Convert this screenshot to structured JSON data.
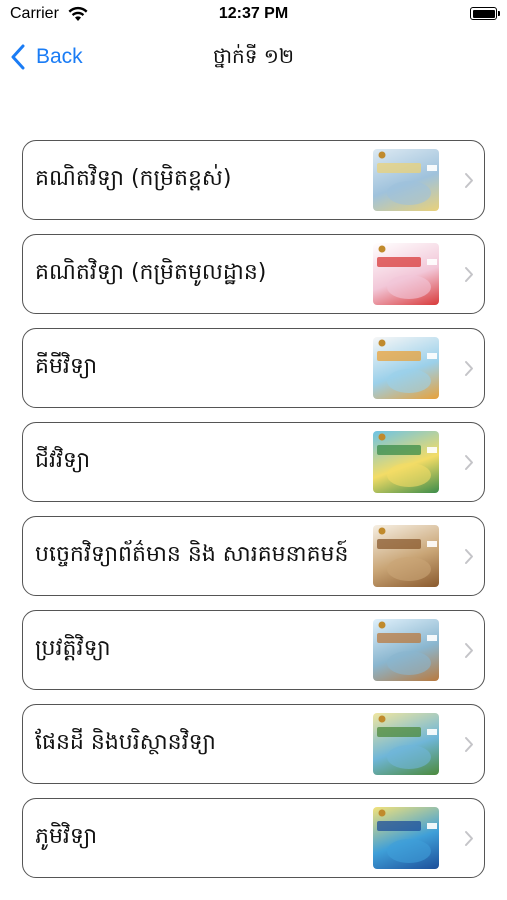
{
  "status_bar": {
    "carrier": "Carrier",
    "time": "12:37 PM"
  },
  "nav": {
    "back_label": "Back",
    "title": "ថ្នាក់ទី ១២"
  },
  "items": [
    {
      "label": "គណិតវិទ្យា (កម្រិតខ្ពស់)",
      "cover_title": "គណិតវិទ្យា",
      "cover_colors": [
        "#dce9f2",
        "#9fc2dc",
        "#e9d17a"
      ]
    },
    {
      "label": "គណិតវិទ្យា (កម្រិតមូលដ្ឋាន)",
      "cover_title": "គណិតវិទ្យា",
      "cover_colors": [
        "#ffffff",
        "#f2c7d8",
        "#d83a3a"
      ]
    },
    {
      "label": "គីមីវិទ្យា",
      "cover_title": "គីមីវិទ្យា",
      "cover_colors": [
        "#f7f7f7",
        "#9bd0ea",
        "#e8a13a"
      ]
    },
    {
      "label": "ជីវវិទ្យា",
      "cover_title": "ជីវវិទ្យា",
      "cover_colors": [
        "#6cc3e6",
        "#f3dc66",
        "#3b8c4a"
      ]
    },
    {
      "label": "បច្ចេកវិទ្យាព័ត៌មាន និង សារគមនាគមន៍",
      "cover_title": "",
      "cover_colors": [
        "#f6efe3",
        "#c9a576",
        "#8a5a2e"
      ]
    },
    {
      "label": "ប្រវត្តិវិទ្យា",
      "cover_title": "ប្រវត្តិវិទ្យា",
      "cover_colors": [
        "#dff0fb",
        "#8ab6cf",
        "#b97a3f"
      ]
    },
    {
      "label": "ផែនដី និងបរិស្ថានវិទ្យា",
      "cover_title": "ផែនដី",
      "cover_colors": [
        "#f0e6a0",
        "#6fb6d8",
        "#4c8a3c"
      ]
    },
    {
      "label": "ភូមិវិទ្យា",
      "cover_title": "ភូមិវិទ្យា",
      "cover_colors": [
        "#f3e27a",
        "#3f9fd8",
        "#1d4f9a"
      ]
    }
  ]
}
